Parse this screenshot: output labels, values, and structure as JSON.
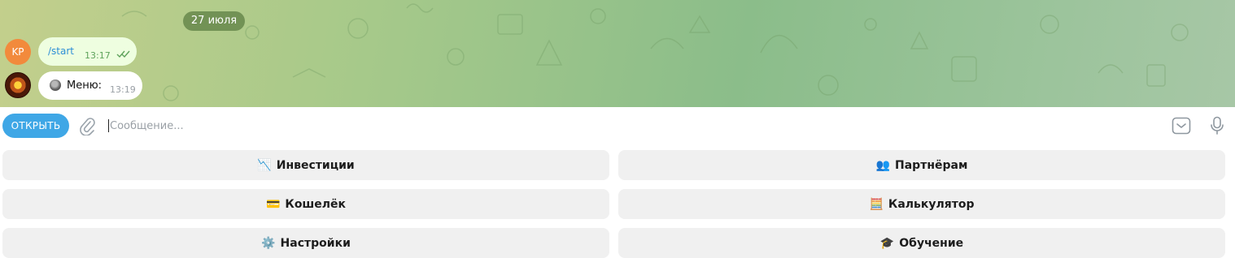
{
  "chat": {
    "date_label": "27 июля",
    "messages": [
      {
        "sender_initials": "KP",
        "text": "/start",
        "time": "13:17",
        "status": "read"
      },
      {
        "sender": "bot",
        "text": "Меню:",
        "time": "13:19",
        "icon": "black-circle-button-icon"
      }
    ]
  },
  "input": {
    "open_button_label": "ОТКРЫТЬ",
    "placeholder": "Сообщение...",
    "value": ""
  },
  "keyboard": {
    "buttons": [
      {
        "icon": "📉",
        "icon_name": "chart-decreasing-icon",
        "label": "Инвестиции"
      },
      {
        "icon": "👥",
        "icon_name": "people-icon",
        "label": "Партнёрам"
      },
      {
        "icon": "💳",
        "icon_name": "credit-card-icon",
        "label": "Кошелёк"
      },
      {
        "icon": "🧮",
        "icon_name": "abacus-icon",
        "label": "Калькулятор"
      },
      {
        "icon": "⚙️",
        "icon_name": "gear-icon",
        "label": "Настройки"
      },
      {
        "icon": "🎓",
        "icon_name": "graduation-cap-icon",
        "label": "Обучение"
      }
    ]
  },
  "colors": {
    "accent": "#3fa7e6",
    "outgoing_bubble": "#eefee0",
    "link": "#2e8fd6",
    "avatar_kp": "#f28a3c"
  }
}
